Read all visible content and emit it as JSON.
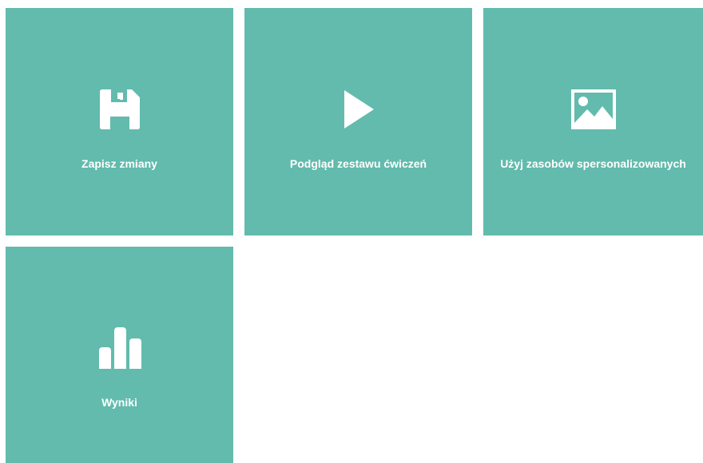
{
  "colors": {
    "tile_background": "#62bbad",
    "tile_foreground": "#ffffff",
    "page_background": "#ffffff"
  },
  "tiles": [
    {
      "label": "Zapisz zmiany",
      "icon": "floppy-disk-icon"
    },
    {
      "label": "Podgląd zestawu ćwiczeń",
      "icon": "play-icon"
    },
    {
      "label": "Użyj zasobów spersonalizowanych",
      "icon": "image-icon"
    },
    {
      "label": "Wyniki",
      "icon": "bar-chart-icon"
    }
  ]
}
